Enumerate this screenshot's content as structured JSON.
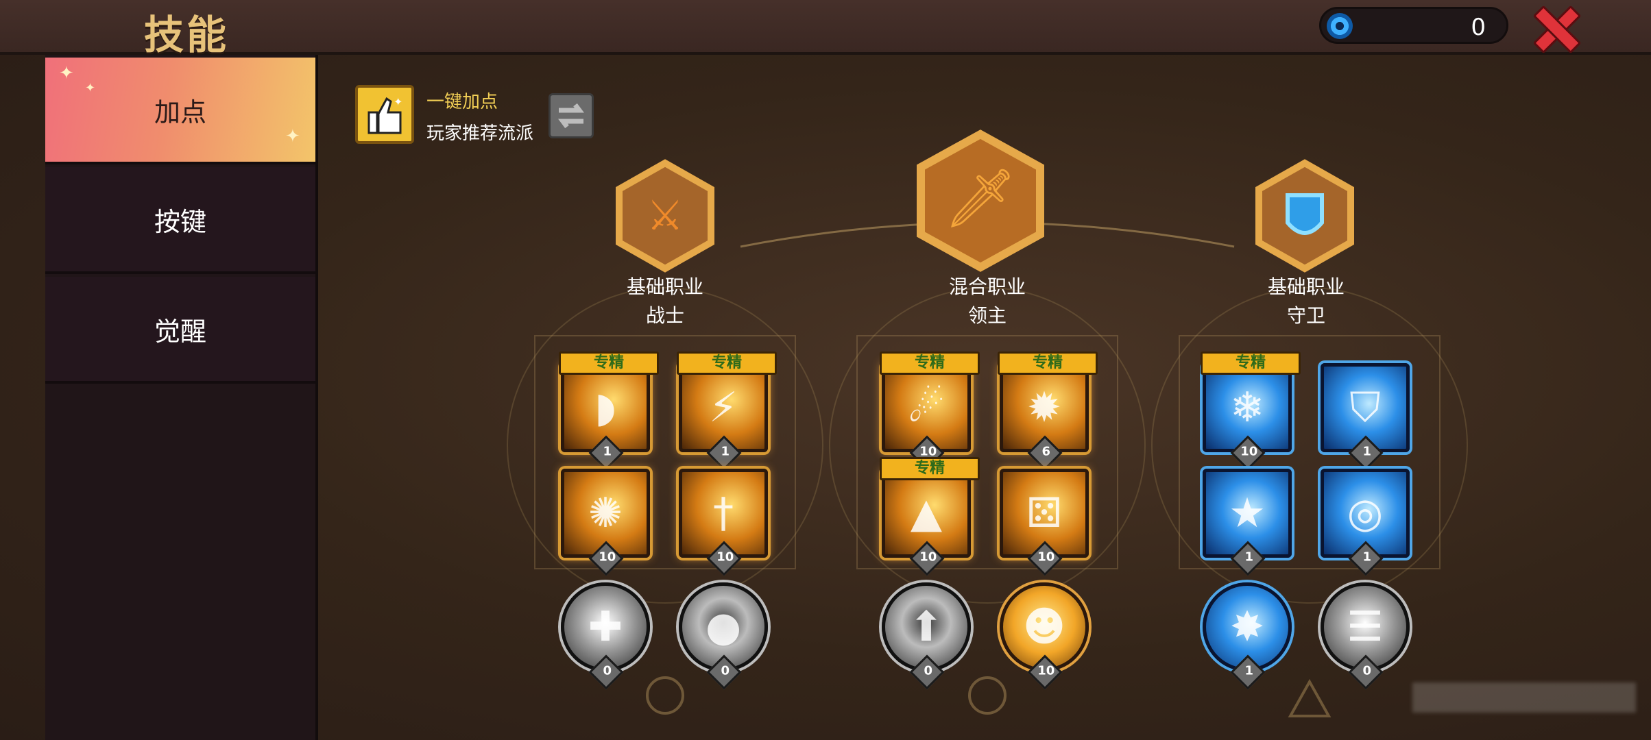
{
  "header": {
    "title": "技能",
    "currency_value": "0"
  },
  "sidebar": {
    "tabs": [
      {
        "label": "加点"
      },
      {
        "label": "按键"
      },
      {
        "label": "觉醒"
      }
    ]
  },
  "recommend": {
    "title": "一键加点",
    "subtitle": "玩家推荐流派"
  },
  "classes": [
    {
      "type": "基础职业",
      "name": "战士",
      "skills": [
        {
          "badge": "专精",
          "level": "1"
        },
        {
          "badge": "专精",
          "level": "1"
        },
        {
          "badge": "",
          "level": "10"
        },
        {
          "badge": "",
          "level": "10"
        },
        {
          "badge": "",
          "level": "0"
        },
        {
          "badge": "",
          "level": "0"
        }
      ]
    },
    {
      "type": "混合职业",
      "name": "领主",
      "skills": [
        {
          "badge": "专精",
          "level": "10"
        },
        {
          "badge": "专精",
          "level": "6"
        },
        {
          "badge": "专精",
          "level": "10"
        },
        {
          "badge": "",
          "level": "10"
        },
        {
          "badge": "",
          "level": "0"
        },
        {
          "badge": "",
          "level": "10"
        }
      ]
    },
    {
      "type": "基础职业",
      "name": "守卫",
      "skills": [
        {
          "badge": "专精",
          "level": "10"
        },
        {
          "badge": "",
          "level": "1"
        },
        {
          "badge": "",
          "level": "1"
        },
        {
          "badge": "",
          "level": "1"
        },
        {
          "badge": "",
          "level": "1"
        },
        {
          "badge": "",
          "level": "0"
        }
      ]
    }
  ],
  "colors": {
    "accent_gold": "#f1c232",
    "tab_active_start": "#f0707a",
    "tab_active_end": "#f3c56a",
    "close_red": "#e0333a"
  }
}
